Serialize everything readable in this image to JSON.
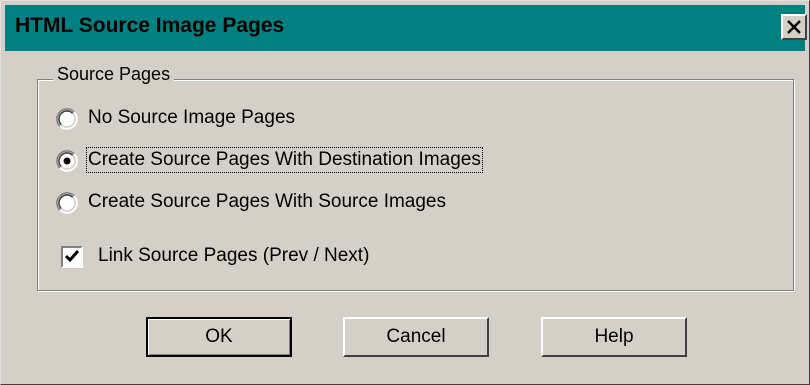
{
  "window": {
    "title": "HTML Source Image Pages",
    "close_symbol": "×"
  },
  "group": {
    "label": "Source Pages"
  },
  "options": [
    {
      "label": "No Source Image Pages",
      "selected": false
    },
    {
      "label": "Create Source Pages With Destination Images",
      "selected": true
    },
    {
      "label": "Create Source Pages With Source Images",
      "selected": false
    }
  ],
  "checkbox": {
    "label": "Link Source Pages (Prev / Next)",
    "checked": true
  },
  "buttons": {
    "ok": "OK",
    "cancel": "Cancel",
    "help": "Help"
  },
  "colors": {
    "titlebar": "#008080",
    "face": "#d4d0c8"
  }
}
